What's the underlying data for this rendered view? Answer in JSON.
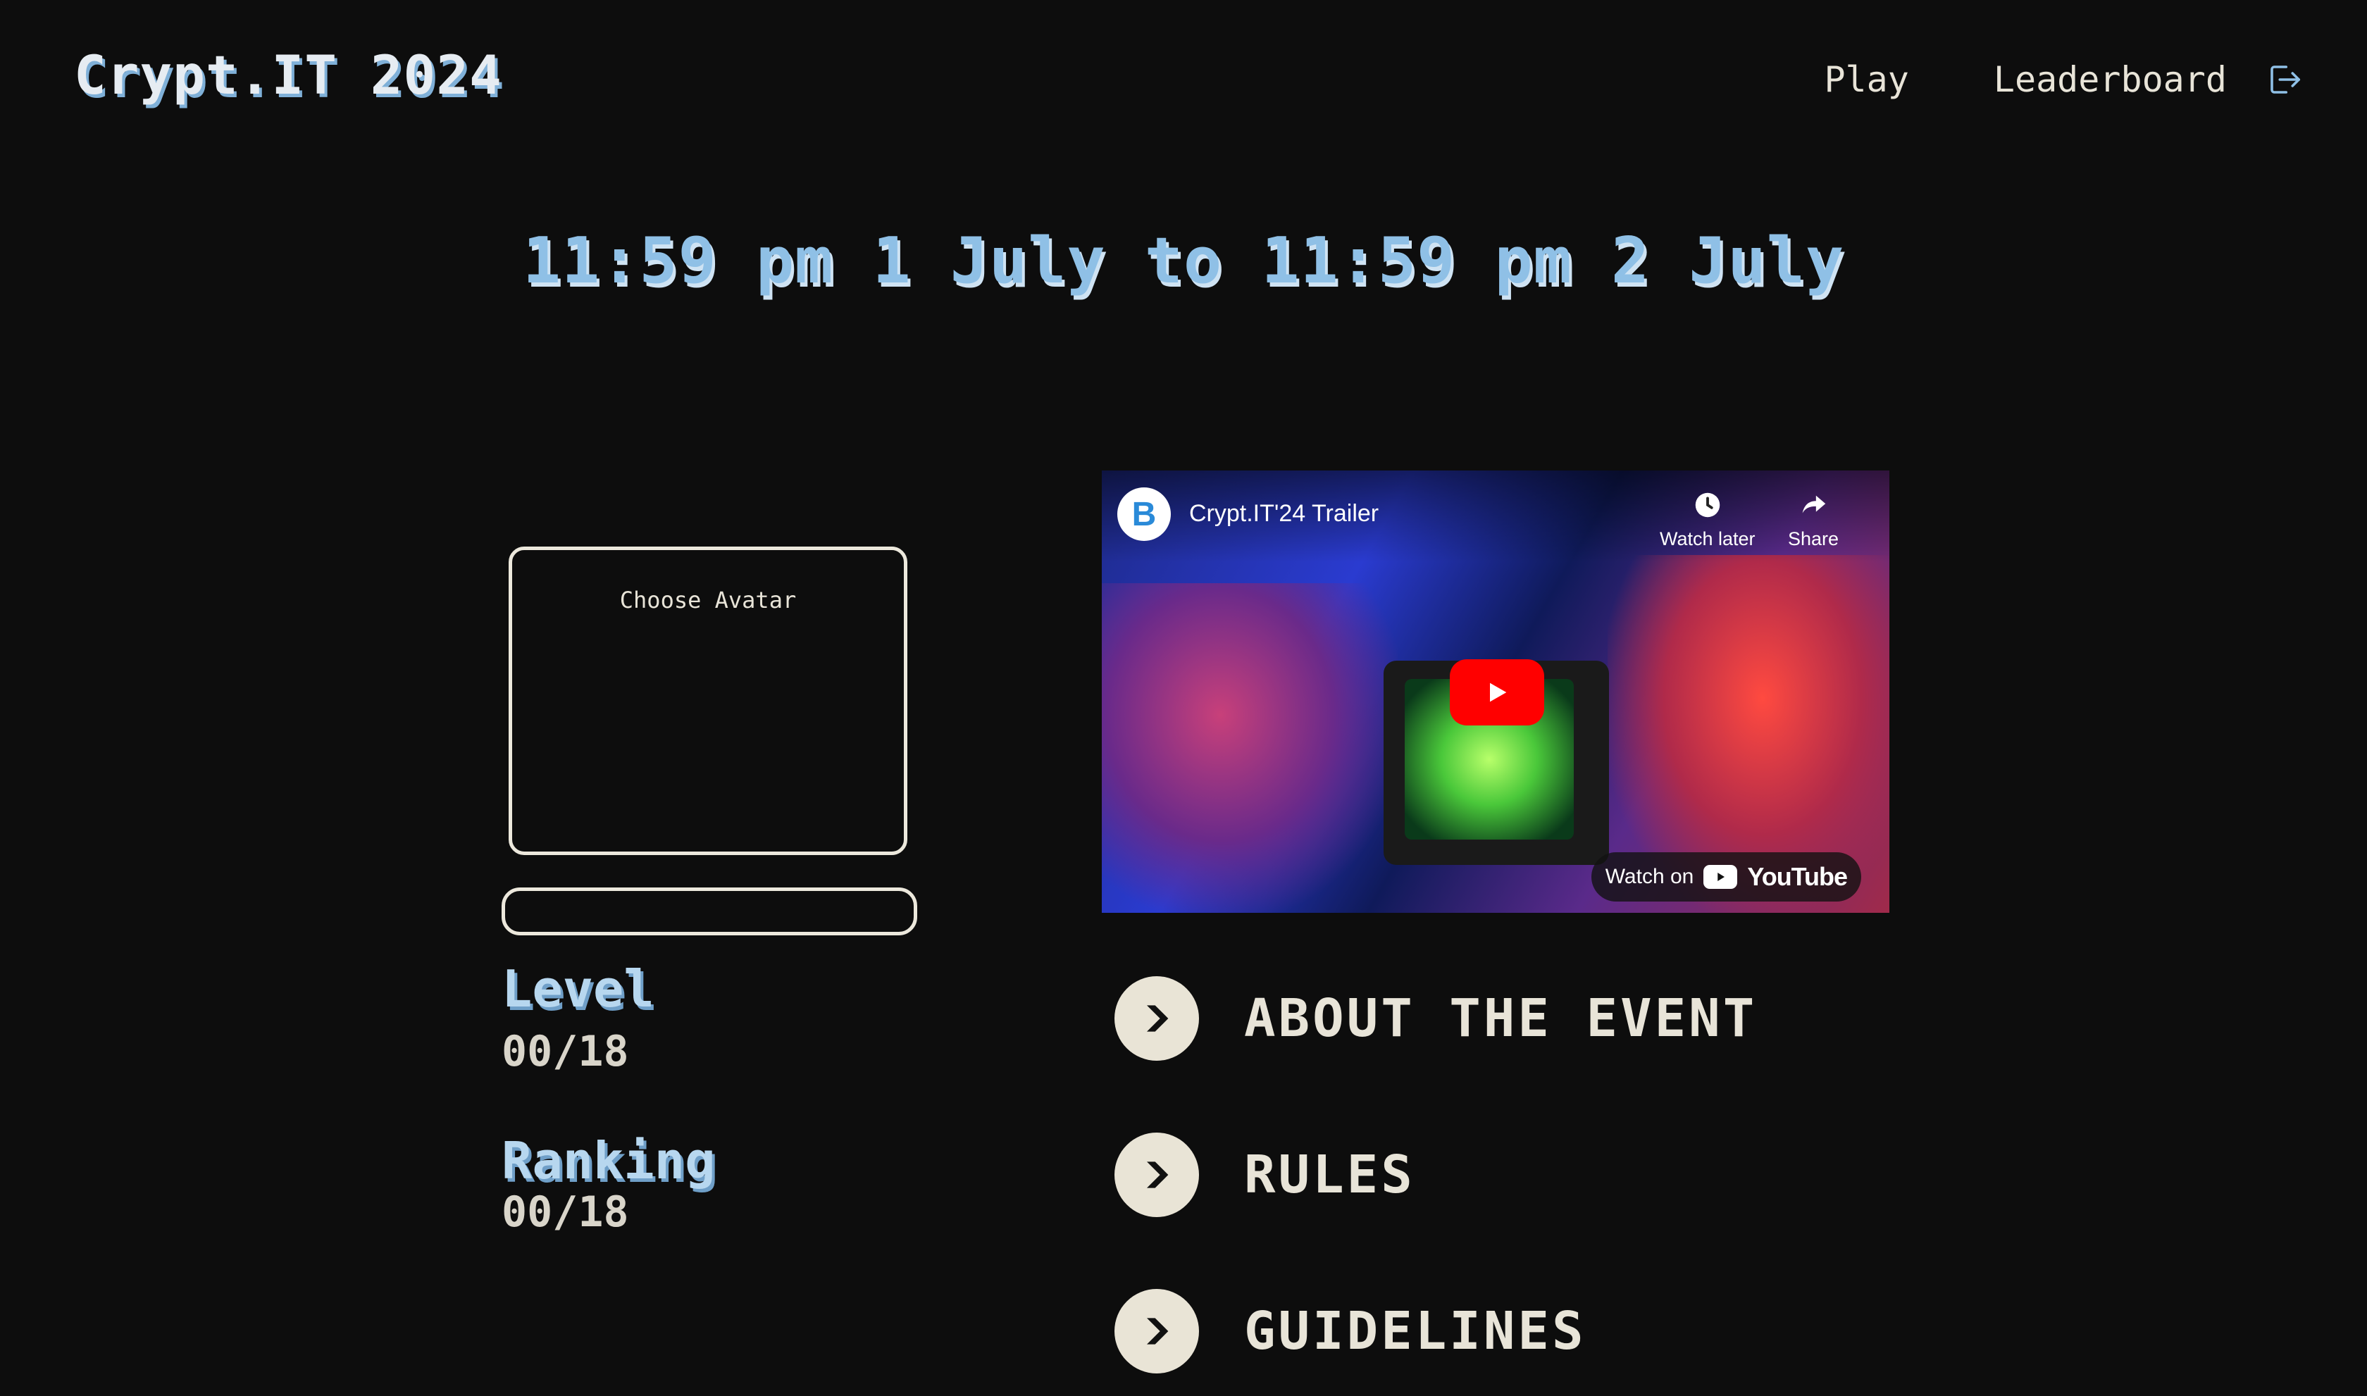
{
  "header": {
    "brand": "Crypt.IT 2024",
    "nav": {
      "play": "Play",
      "leaderboard": "Leaderboard"
    }
  },
  "event": {
    "time": "11:59 pm 1 July to 11:59 pm 2 July"
  },
  "avatar": {
    "label": "Choose Avatar"
  },
  "progress": {
    "value": 0
  },
  "stats": {
    "level_label": "Level",
    "level_value": "00/18",
    "ranking_label": "Ranking",
    "ranking_value": "00/18"
  },
  "video": {
    "channel_logo_letter": "B",
    "title": "Crypt.IT'24 Trailer",
    "watch_later": "Watch later",
    "share": "Share",
    "watch_on": "Watch on",
    "youtube": "YouTube"
  },
  "info": {
    "items": [
      {
        "label": "ABOUT THE EVENT"
      },
      {
        "label": "RULES"
      },
      {
        "label": "GUIDELINES"
      }
    ]
  },
  "colors": {
    "background": "#0d0d0d",
    "accent_blue": "#8fc0e6",
    "cream": "#e8e4d8",
    "play_red": "#ff0000"
  }
}
